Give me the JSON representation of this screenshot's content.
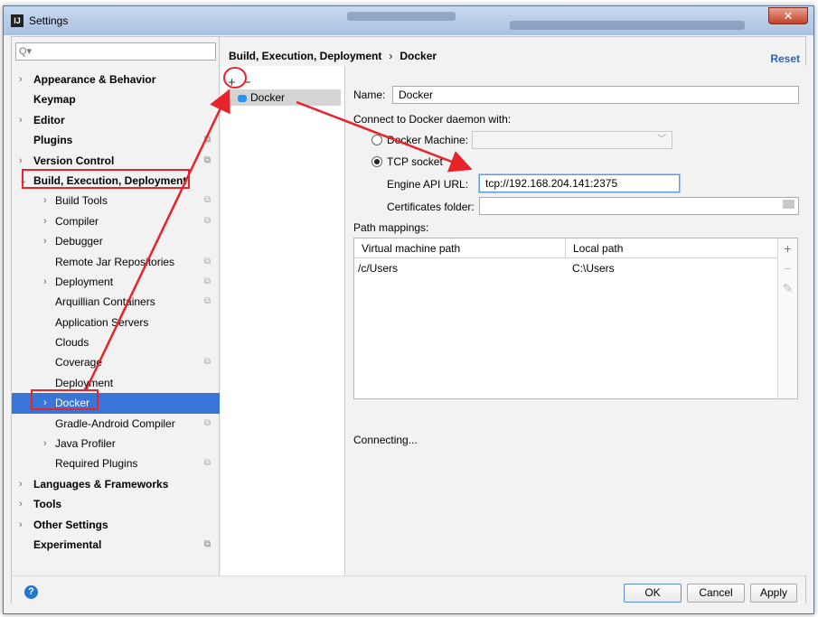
{
  "window": {
    "title": "Settings"
  },
  "search": {
    "placeholder": ""
  },
  "tree": [
    {
      "label": "Appearance & Behavior",
      "level": 1,
      "bold": true,
      "arrow": true,
      "page": false
    },
    {
      "label": "Keymap",
      "level": 1,
      "bold": true,
      "arrow": false,
      "page": false
    },
    {
      "label": "Editor",
      "level": 1,
      "bold": true,
      "arrow": true,
      "page": false
    },
    {
      "label": "Plugins",
      "level": 1,
      "bold": true,
      "arrow": false,
      "page": true
    },
    {
      "label": "Version Control",
      "level": 1,
      "bold": true,
      "arrow": true,
      "page": true
    },
    {
      "label": "Build, Execution, Deployment",
      "level": 1,
      "bold": true,
      "arrow": true,
      "expanded": true,
      "page": false
    },
    {
      "label": "Build Tools",
      "level": 2,
      "arrow": true,
      "page": true
    },
    {
      "label": "Compiler",
      "level": 2,
      "arrow": true,
      "page": true
    },
    {
      "label": "Debugger",
      "level": 2,
      "arrow": true,
      "page": false
    },
    {
      "label": "Remote Jar Repositories",
      "level": 2,
      "arrow": false,
      "page": true
    },
    {
      "label": "Deployment",
      "level": 2,
      "arrow": true,
      "page": true
    },
    {
      "label": "Arquillian Containers",
      "level": 2,
      "arrow": false,
      "page": true
    },
    {
      "label": "Application Servers",
      "level": 2,
      "arrow": false,
      "page": false
    },
    {
      "label": "Clouds",
      "level": 2,
      "arrow": false,
      "page": false
    },
    {
      "label": "Coverage",
      "level": 2,
      "arrow": false,
      "page": true
    },
    {
      "label": "Deployment",
      "level": 2,
      "arrow": false,
      "page": false
    },
    {
      "label": "Docker",
      "level": 2,
      "arrow": true,
      "page": false,
      "selected": true
    },
    {
      "label": "Gradle-Android Compiler",
      "level": 2,
      "arrow": false,
      "page": true
    },
    {
      "label": "Java Profiler",
      "level": 2,
      "arrow": true,
      "page": false
    },
    {
      "label": "Required Plugins",
      "level": 2,
      "arrow": false,
      "page": true
    },
    {
      "label": "Languages & Frameworks",
      "level": 1,
      "bold": true,
      "arrow": true,
      "page": false
    },
    {
      "label": "Tools",
      "level": 1,
      "bold": true,
      "arrow": true,
      "page": false
    },
    {
      "label": "Other Settings",
      "level": 1,
      "bold": true,
      "arrow": true,
      "page": false
    },
    {
      "label": "Experimental",
      "level": 1,
      "bold": true,
      "arrow": false,
      "page": true
    }
  ],
  "header": {
    "crumb_parent": "Build, Execution, Deployment",
    "crumb_sep": "›",
    "crumb_current": "Docker",
    "reset": "Reset"
  },
  "middle": {
    "add": "+",
    "remove": "−",
    "item": "Docker"
  },
  "form": {
    "name_label": "Name:",
    "name_value": "Docker",
    "connect_label": "Connect to Docker daemon with:",
    "docker_machine_label": "Docker Machine:",
    "docker_machine_value": "",
    "tcp_label": "TCP socket",
    "engine_label": "Engine API URL:",
    "engine_value": "tcp://192.168.204.141:2375",
    "cert_label": "Certificates folder:",
    "cert_value": "",
    "path_mappings_label": "Path mappings:",
    "status": "Connecting..."
  },
  "table": {
    "columns": [
      "Virtual machine path",
      "Local path"
    ],
    "rows": [
      [
        "/c/Users",
        "C:\\Users"
      ]
    ]
  },
  "buttons": {
    "ok": "OK",
    "cancel": "Cancel",
    "apply": "Apply",
    "help": "?"
  },
  "annotation_color": "#e8232a"
}
